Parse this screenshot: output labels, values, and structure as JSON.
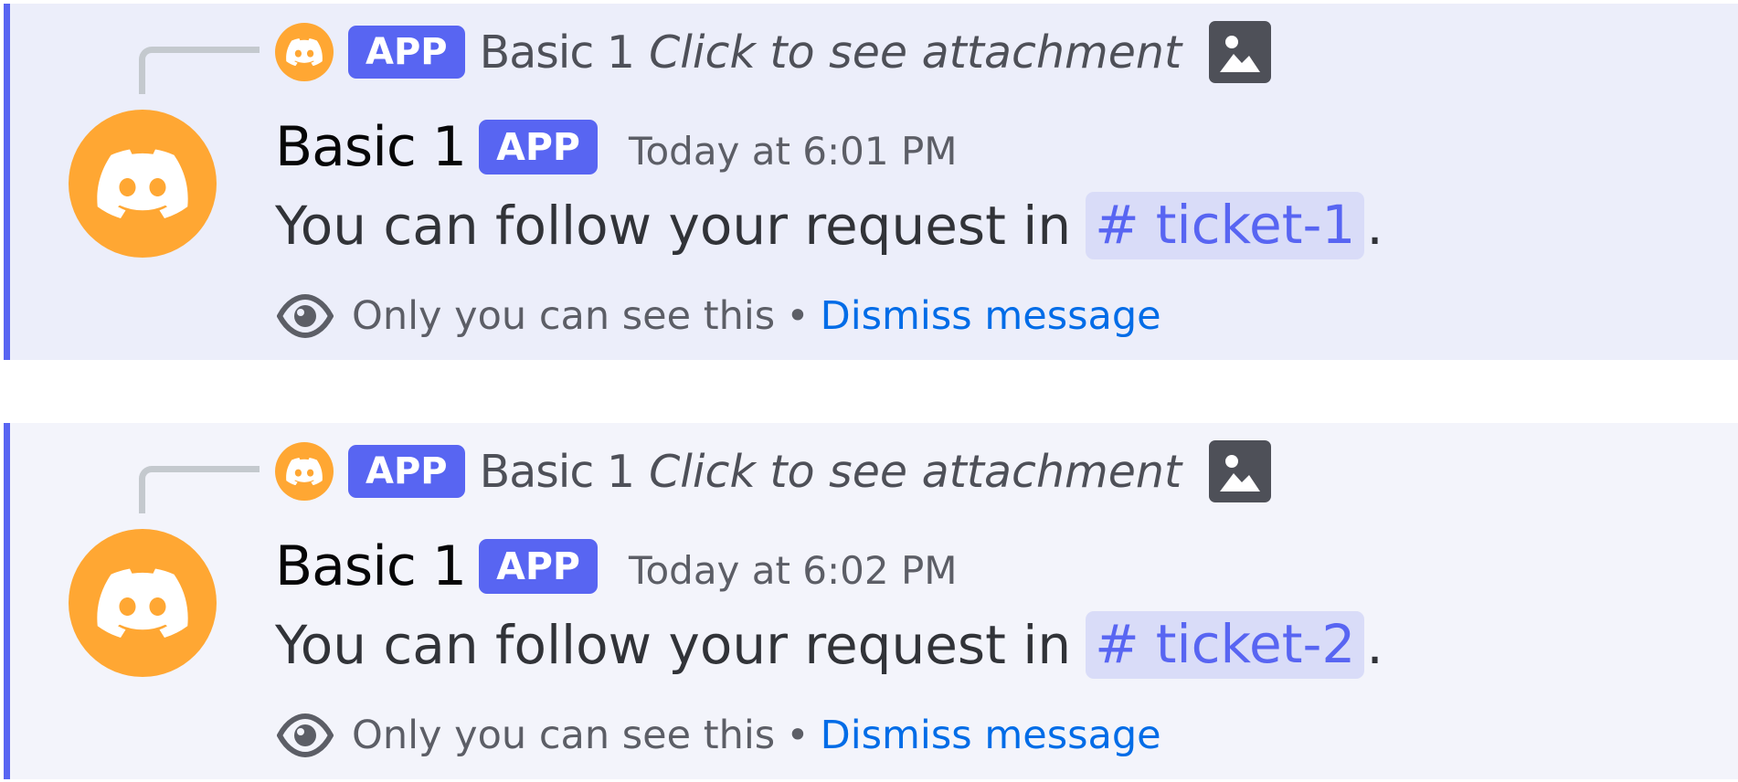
{
  "messages": [
    {
      "reply": {
        "app_tag": "APP",
        "author": "Basic 1",
        "text": "Click to see attachment",
        "attachment_icon": "image-icon"
      },
      "author": "Basic 1",
      "app_tag": "APP",
      "timestamp": "Today at 6:01 PM",
      "content_prefix": "You can follow your request in",
      "channel_mention": "ticket-1",
      "hash": "#",
      "content_suffix": ".",
      "ephemeral_notice": "Only you can see this",
      "separator": "•",
      "dismiss_label": "Dismiss message"
    },
    {
      "reply": {
        "app_tag": "APP",
        "author": "Basic 1",
        "text": "Click to see attachment",
        "attachment_icon": "image-icon"
      },
      "author": "Basic 1",
      "app_tag": "APP",
      "timestamp": "Today at 6:02 PM",
      "content_prefix": "You can follow your request in",
      "channel_mention": "ticket-2",
      "hash": "#",
      "content_suffix": ".",
      "ephemeral_notice": "Only you can see this",
      "separator": "•",
      "dismiss_label": "Dismiss message"
    }
  ],
  "colors": {
    "accent": "#5865f2",
    "avatar": "#ffa733",
    "link": "#006ce7",
    "highlight_bg": "#eceefa"
  }
}
